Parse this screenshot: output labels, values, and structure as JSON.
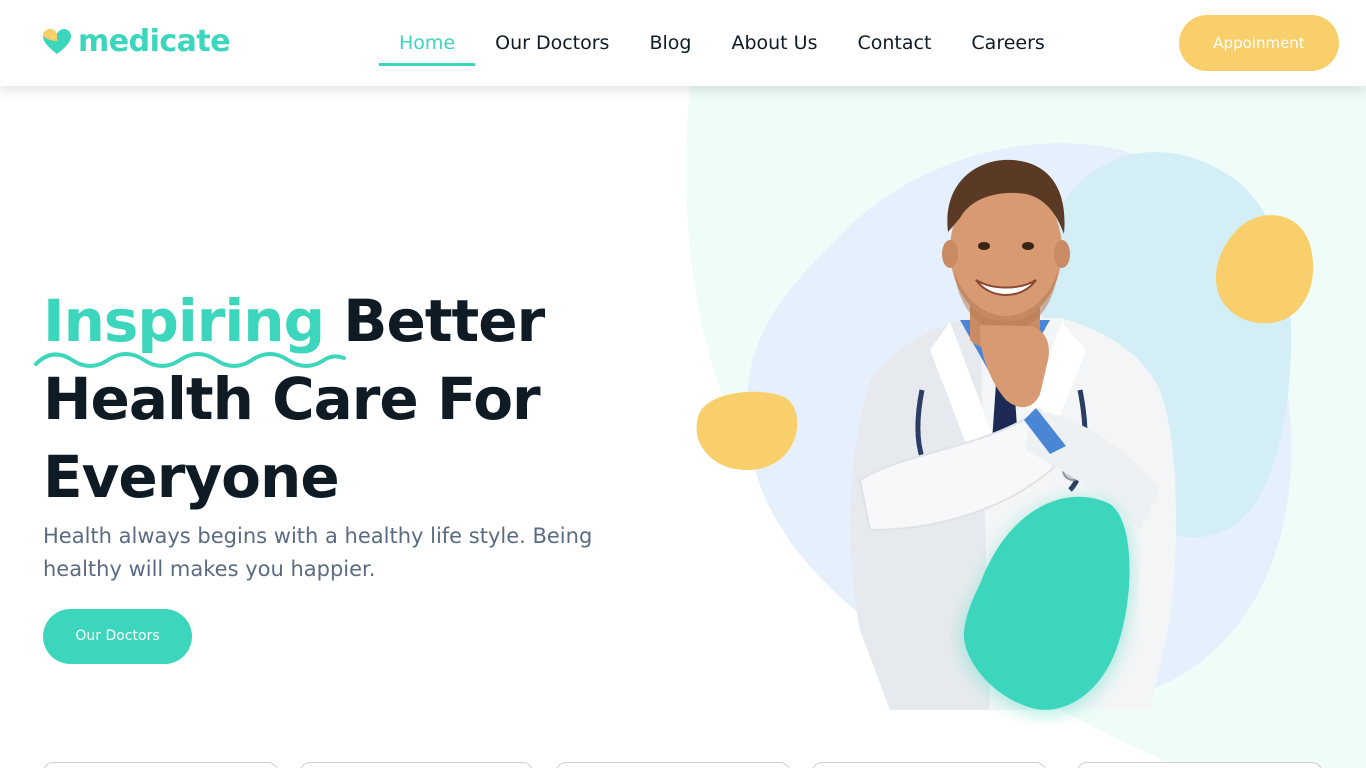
{
  "brand": {
    "name": "medicate",
    "accent": "#3cd6bc",
    "secondary": "#f8cf6a",
    "logo_icon": "heart-icon"
  },
  "nav": {
    "items": [
      {
        "label": "Home",
        "active": true
      },
      {
        "label": "Our Doctors",
        "active": false
      },
      {
        "label": "Blog",
        "active": false
      },
      {
        "label": "About Us",
        "active": false
      },
      {
        "label": "Contact",
        "active": false
      },
      {
        "label": "Careers",
        "active": false
      }
    ],
    "cta_label": "Appoinment"
  },
  "hero": {
    "title_accent": "Inspiring",
    "title_line1_rest": " Better",
    "title_line2": "Health Care For",
    "title_line3": "Everyone",
    "subtitle": "Health always begins with a healthy life style. Being healthy will makes you happier.",
    "cta_label": "Our Doctors"
  },
  "cards": {
    "count": 5
  }
}
